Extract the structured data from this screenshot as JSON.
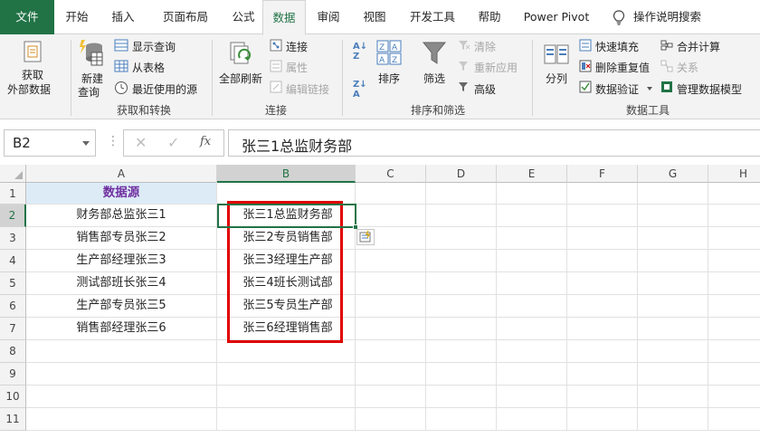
{
  "tabs": [
    {
      "label": "文件"
    },
    {
      "label": "开始"
    },
    {
      "label": "插入"
    },
    {
      "label": "页面布局"
    },
    {
      "label": "公式"
    },
    {
      "label": "数据"
    },
    {
      "label": "审阅"
    },
    {
      "label": "视图"
    },
    {
      "label": "开发工具"
    },
    {
      "label": "帮助"
    },
    {
      "label": "Power Pivot"
    }
  ],
  "tell_me": "操作说明搜索",
  "ribbon": {
    "get_external": [
      "获取",
      "外部数据"
    ],
    "new_query": [
      "新建",
      "查询"
    ],
    "show_queries": "显示查询",
    "from_table": "从表格",
    "recent_sources": "最近使用的源",
    "group_get_transform": "获取和转换",
    "refresh_all": "全部刷新",
    "connections": "连接",
    "properties": "属性",
    "edit_links": "编辑链接",
    "group_connections": "连接",
    "sort": "排序",
    "filter": "筛选",
    "clear": "清除",
    "reapply": "重新应用",
    "advanced": "高级",
    "group_sort_filter": "排序和筛选",
    "text_to_columns": "分列",
    "flash_fill": "快速填充",
    "remove_duplicates": "删除重复值",
    "data_validation": "数据验证",
    "consolidate": "合并计算",
    "relationships": "关系",
    "manage_data_model": "管理数据模型",
    "group_data_tools": "数据工具"
  },
  "formula_bar": {
    "name_box": "B2",
    "formula": "张三1总监财务部"
  },
  "columns": [
    "A",
    "B",
    "C",
    "D",
    "E",
    "F",
    "G",
    "H"
  ],
  "rows": [
    "1",
    "2",
    "3",
    "4",
    "5",
    "6",
    "7",
    "8",
    "9",
    "10",
    "11"
  ],
  "cells": {
    "A1": "数据源",
    "A": [
      "财务部总监张三1",
      "销售部专员张三2",
      "生产部经理张三3",
      "测试部班长张三4",
      "生产部专员张三5",
      "销售部经理张三6"
    ],
    "B": [
      "张三1总监财务部",
      "张三2专员销售部",
      "张三3经理生产部",
      "张三4班长测试部",
      "张三5专员生产部",
      "张三6经理销售部"
    ]
  },
  "colors": {
    "excel_green": "#217346",
    "header_fill": "#ddebf7",
    "header_text": "#7030a0",
    "highlight_border": "#e00000"
  }
}
